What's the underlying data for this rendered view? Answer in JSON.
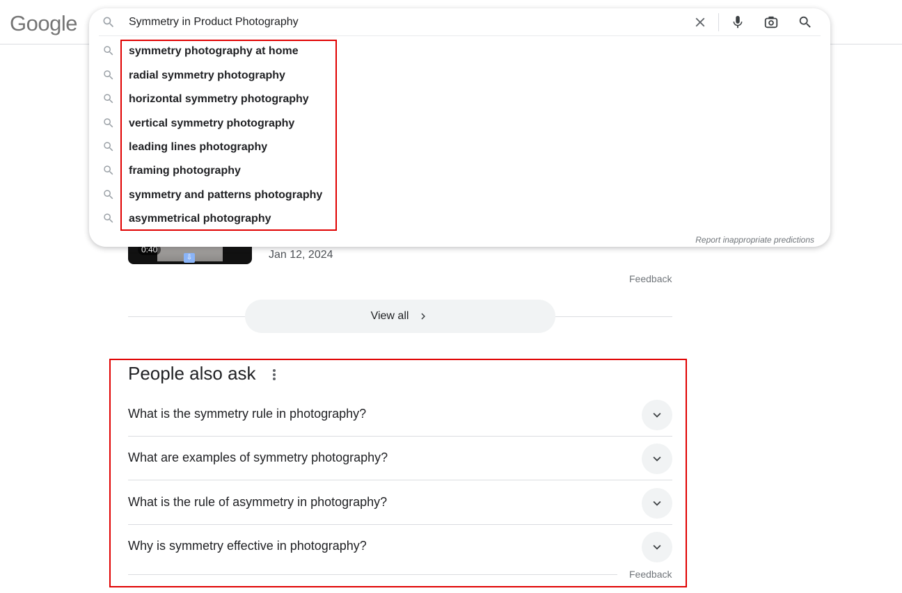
{
  "logo": "Google",
  "search": {
    "query": "Symmetry in Product Photography",
    "suggestions": [
      "symmetry photography at home",
      "radial symmetry photography",
      "horizontal symmetry photography",
      "vertical symmetry photography",
      "leading lines photography",
      "framing photography",
      "symmetry and patterns photography",
      "asymmetrical photography"
    ],
    "report_link": "Report inappropriate predictions",
    "tools": [
      "close-icon",
      "microphone-icon",
      "lens-icon",
      "search-icon"
    ]
  },
  "video": {
    "duration": "0:40",
    "date": "Jan 12, 2024"
  },
  "feedback_label": "Feedback",
  "view_all": "View all",
  "paa": {
    "title": "People also ask",
    "questions": [
      "What is the symmetry rule in photography?",
      "What are examples of symmetry photography?",
      "What is the rule of asymmetry in photography?",
      "Why is symmetry effective in photography?"
    ]
  },
  "colors": {
    "annotation_red": "#e00000",
    "chip_bg": "#f1f3f4",
    "muted_text": "#70757a"
  }
}
